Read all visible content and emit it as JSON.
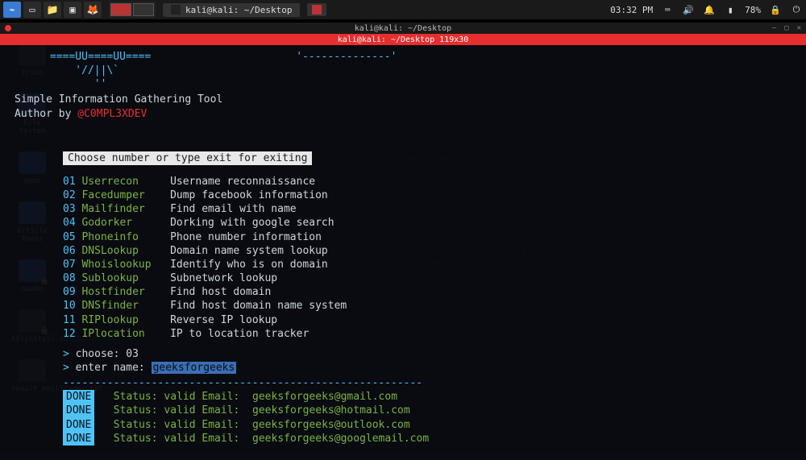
{
  "taskbar": {
    "apps": [
      {
        "label": "kali@kali: ~/Desktop"
      }
    ],
    "time": "03:32 PM",
    "battery": "78%"
  },
  "desktop_icons": [
    {
      "name": "Trash",
      "kind": "trash"
    },
    {
      "name": "File System",
      "kind": "folder"
    },
    {
      "name": "Home",
      "kind": "folder"
    },
    {
      "name": "Article Tools",
      "kind": "folder"
    },
    {
      "name": "naabu",
      "kind": "folder",
      "locked": true
    },
    {
      "name": "kalinstall.sh",
      "kind": "file",
      "locked": true
    },
    {
      "name": "result_mailfinder.txt",
      "kind": "file"
    }
  ],
  "terminal": {
    "title": "kali@kali: ~/Desktop",
    "subtitle": "kali@kali: ~/Desktop 119x30",
    "ascii": {
      "line1": "====UU====UU====",
      "line2": "    '//||\\`",
      "line3": "       ''",
      "dashes": "'--------------'"
    },
    "tool_title": "Simple Information Gathering Tool",
    "author_prefix": "Author by ",
    "author_handle": "@C0MPL3XDEV",
    "menu_header": " Choose number or type exit for exiting ",
    "menu": [
      {
        "num": "01",
        "name": "Userrecon",
        "desc": "Username reconnaissance"
      },
      {
        "num": "02",
        "name": "Facedumper",
        "desc": "Dump facebook information"
      },
      {
        "num": "03",
        "name": "Mailfinder",
        "desc": "Find email with name"
      },
      {
        "num": "04",
        "name": "Godorker",
        "desc": "Dorking with google search"
      },
      {
        "num": "05",
        "name": "Phoneinfo",
        "desc": "Phone number information"
      },
      {
        "num": "06",
        "name": "DNSLookup",
        "desc": "Domain name system lookup"
      },
      {
        "num": "07",
        "name": "Whoislookup",
        "desc": "Identify who is on domain"
      },
      {
        "num": "08",
        "name": "Sublookup",
        "desc": "Subnetwork lookup"
      },
      {
        "num": "09",
        "name": "Hostfinder",
        "desc": "Find host domain"
      },
      {
        "num": "10",
        "name": "DNSfinder",
        "desc": "Find host domain name system"
      },
      {
        "num": "11",
        "name": "RIPlookup",
        "desc": "Reverse IP lookup"
      },
      {
        "num": "12",
        "name": "IPlocation",
        "desc": "IP to location tracker"
      }
    ],
    "prompts": {
      "choose_label": "choose:",
      "choose_value": "03",
      "enter_label": "enter name:",
      "enter_value": "geeksforgeeks"
    },
    "divider": "---------------------------------------------------------",
    "results_done": "DONE",
    "results": [
      {
        "status": "valid",
        "email": "geeksforgeeks@gmail.com"
      },
      {
        "status": "valid",
        "email": "geeksforgeeks@hotmail.com"
      },
      {
        "status": "valid",
        "email": "geeksforgeeks@outlook.com"
      },
      {
        "status": "valid",
        "email": "geeksforgeeks@googlemail.com"
      }
    ],
    "labels": {
      "status": "Status:",
      "email": "Email:"
    }
  }
}
